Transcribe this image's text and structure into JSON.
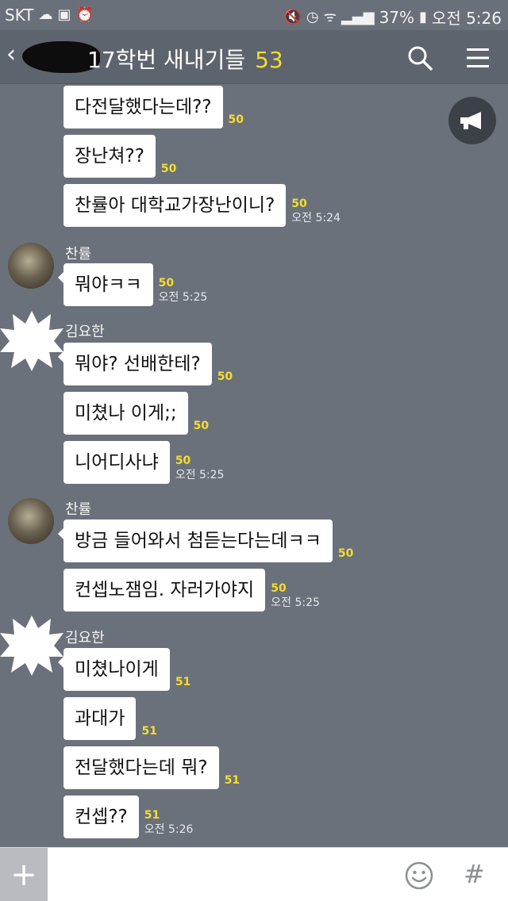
{
  "status_bar": {
    "carrier": "SKT",
    "battery": "37%",
    "time": "오전 5:26",
    "icons": [
      "cloud-icon",
      "image-icon",
      "alarm-icon",
      "mute-icon",
      "wifi-icon",
      "signal-icon",
      "battery-icon"
    ]
  },
  "header": {
    "title": "17학번 새내기들",
    "count": "53"
  },
  "messages": [
    {
      "text": "다전달했다는데??",
      "unread": "50",
      "time": ""
    },
    {
      "text": "장난쳐??",
      "unread": "50",
      "time": ""
    },
    {
      "text": "찬률아 대학교가장난이니?",
      "unread": "50",
      "time": "오전 5:24"
    },
    {
      "sender": "찬률",
      "text": "뭐야ㅋㅋ",
      "unread": "50",
      "time": "오전 5:25"
    },
    {
      "sender": "김요한",
      "text": "뭐야? 선배한테?",
      "unread": "50",
      "time": ""
    },
    {
      "text": "미쳤나 이게;;",
      "unread": "50",
      "time": ""
    },
    {
      "text": "니어디사냐",
      "unread": "50",
      "time": "오전 5:25"
    },
    {
      "sender": "찬률",
      "text": "방금 들어와서 첨듣는다는데ㅋㅋ",
      "unread": "50",
      "time": ""
    },
    {
      "text": "컨셉노잼임. 자러가야지",
      "unread": "50",
      "time": "오전 5:25"
    },
    {
      "sender": "김요한",
      "text": "미쳤나이게",
      "unread": "51",
      "time": ""
    },
    {
      "text": "과대가",
      "unread": "51",
      "time": ""
    },
    {
      "text": "전달했다는데 뭐?",
      "unread": "51",
      "time": ""
    },
    {
      "text": "컨셉??",
      "unread": "51",
      "time": "오전 5:26"
    }
  ],
  "input_bar": {
    "plus_label": "+",
    "hash_label": "#"
  },
  "colors": {
    "background": "#6b717b",
    "header": "#5e646d",
    "unread": "#f5dc2f",
    "bubble": "#ffffff"
  }
}
